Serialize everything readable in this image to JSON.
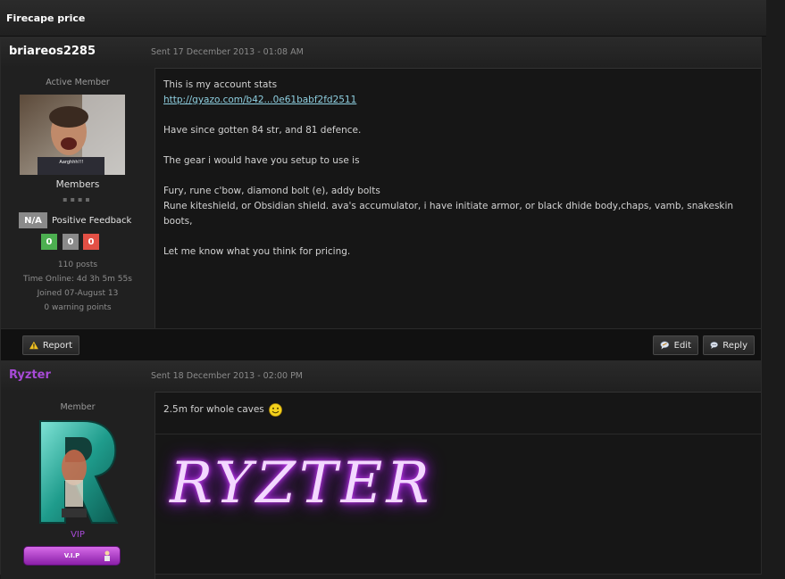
{
  "thread": {
    "title": "Firecape price"
  },
  "posts": [
    {
      "username": "briareos2285",
      "username_color": "#ffffff",
      "sent": "Sent 17 December 2013 - 01:08 AM",
      "rank_title": "Active Member",
      "group": "Members",
      "rank_pips": "▪▪▪▪",
      "feedback_label": "N/A",
      "feedback_text": "Positive Feedback",
      "feedback_counts": [
        "0",
        "0",
        "0"
      ],
      "avatar_caption": "Aarghhh!!!",
      "stats": [
        "110 posts",
        "Time Online: 4d 3h 5m 55s",
        "Joined 07-August 13",
        "0 warning points"
      ],
      "message": {
        "line1": "This is my account stats",
        "link": "http://gyazo.com/b42...0e61babf2fd2511",
        "line2": "Have since gotten 84 str, and 81 defence.",
        "line3": "The gear i would have you setup to use is",
        "line4": "Fury, rune c'bow, diamond bolt (e), addy bolts",
        "line5": "Rune kiteshield, or Obsidian shield. ava's accumulator, i have initiate armor, or black dhide body,chaps, vamb, snakeskin boots,",
        "line6": "Let me know what you think for pricing."
      },
      "buttons": {
        "report": "Report",
        "edit": "Edit",
        "reply": "Reply"
      }
    },
    {
      "username": "Ryzter",
      "username_color": "#a74ad6",
      "sent": "Sent 18 December 2013 - 02:00 PM",
      "rank_title": "Member",
      "group": "VIP",
      "vip_badge": "V.I.P",
      "message": {
        "line1": "2.5m for whole caves"
      },
      "signature": "RYZTER"
    }
  ]
}
